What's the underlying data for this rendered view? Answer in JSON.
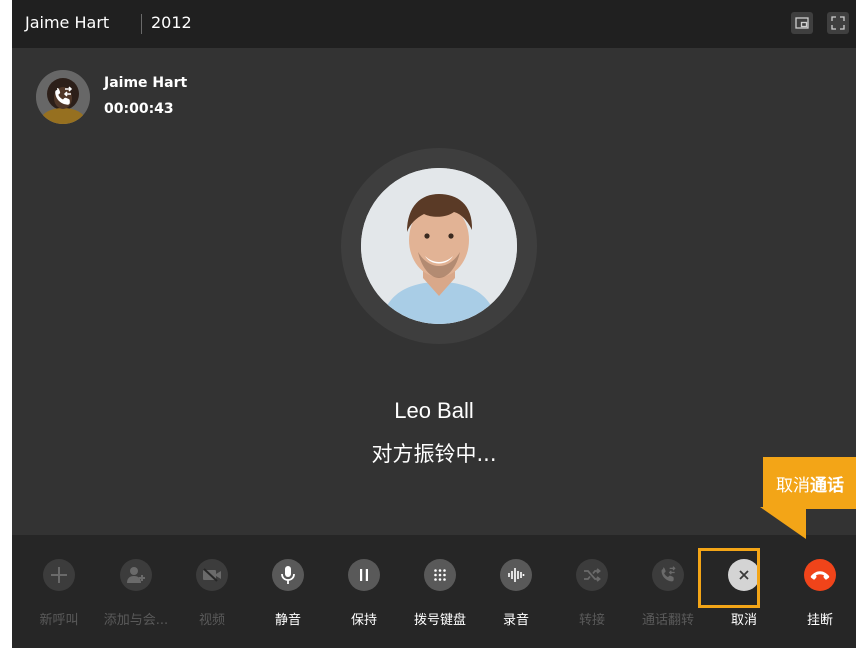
{
  "titlebar": {
    "caller_name": "Jaime Hart",
    "extension": "2012",
    "buttons": [
      {
        "icon": "picture-in-picture-icon"
      },
      {
        "icon": "fullscreen-icon"
      }
    ]
  },
  "caller": {
    "name": "Jaime Hart",
    "timer": "00:00:43",
    "avatar_icon": "call-transfer-icon"
  },
  "callee": {
    "name": "Leo Ball",
    "status": "对方振铃中..."
  },
  "controls": [
    {
      "label": "新呼叫",
      "icon": "plus-icon",
      "enabled": false
    },
    {
      "label": "添加与会...",
      "icon": "add-participant-icon",
      "enabled": false
    },
    {
      "label": "视频",
      "icon": "video-off-icon",
      "enabled": false
    },
    {
      "label": "静音",
      "icon": "microphone-icon",
      "enabled": true
    },
    {
      "label": "保持",
      "icon": "pause-icon",
      "enabled": true
    },
    {
      "label": "拨号键盘",
      "icon": "dialpad-icon",
      "enabled": true
    },
    {
      "label": "录音",
      "icon": "waveform-icon",
      "enabled": true
    },
    {
      "label": "转接",
      "icon": "shuffle-icon",
      "enabled": false
    },
    {
      "label": "通话翻转",
      "icon": "call-flip-icon",
      "enabled": false
    },
    {
      "label": "取消",
      "icon": "close-icon",
      "enabled": true
    },
    {
      "label": "挂断",
      "icon": "hang-up-icon",
      "enabled": true
    }
  ],
  "callout": {
    "text_plain": "取消",
    "text_bold": "通话"
  },
  "colors": {
    "window_bg": "#333333",
    "titlebar_bg": "#202020",
    "toolbar_bg": "#262626",
    "hangup_red": "#f0441a",
    "highlight_orange": "#f3a517"
  }
}
